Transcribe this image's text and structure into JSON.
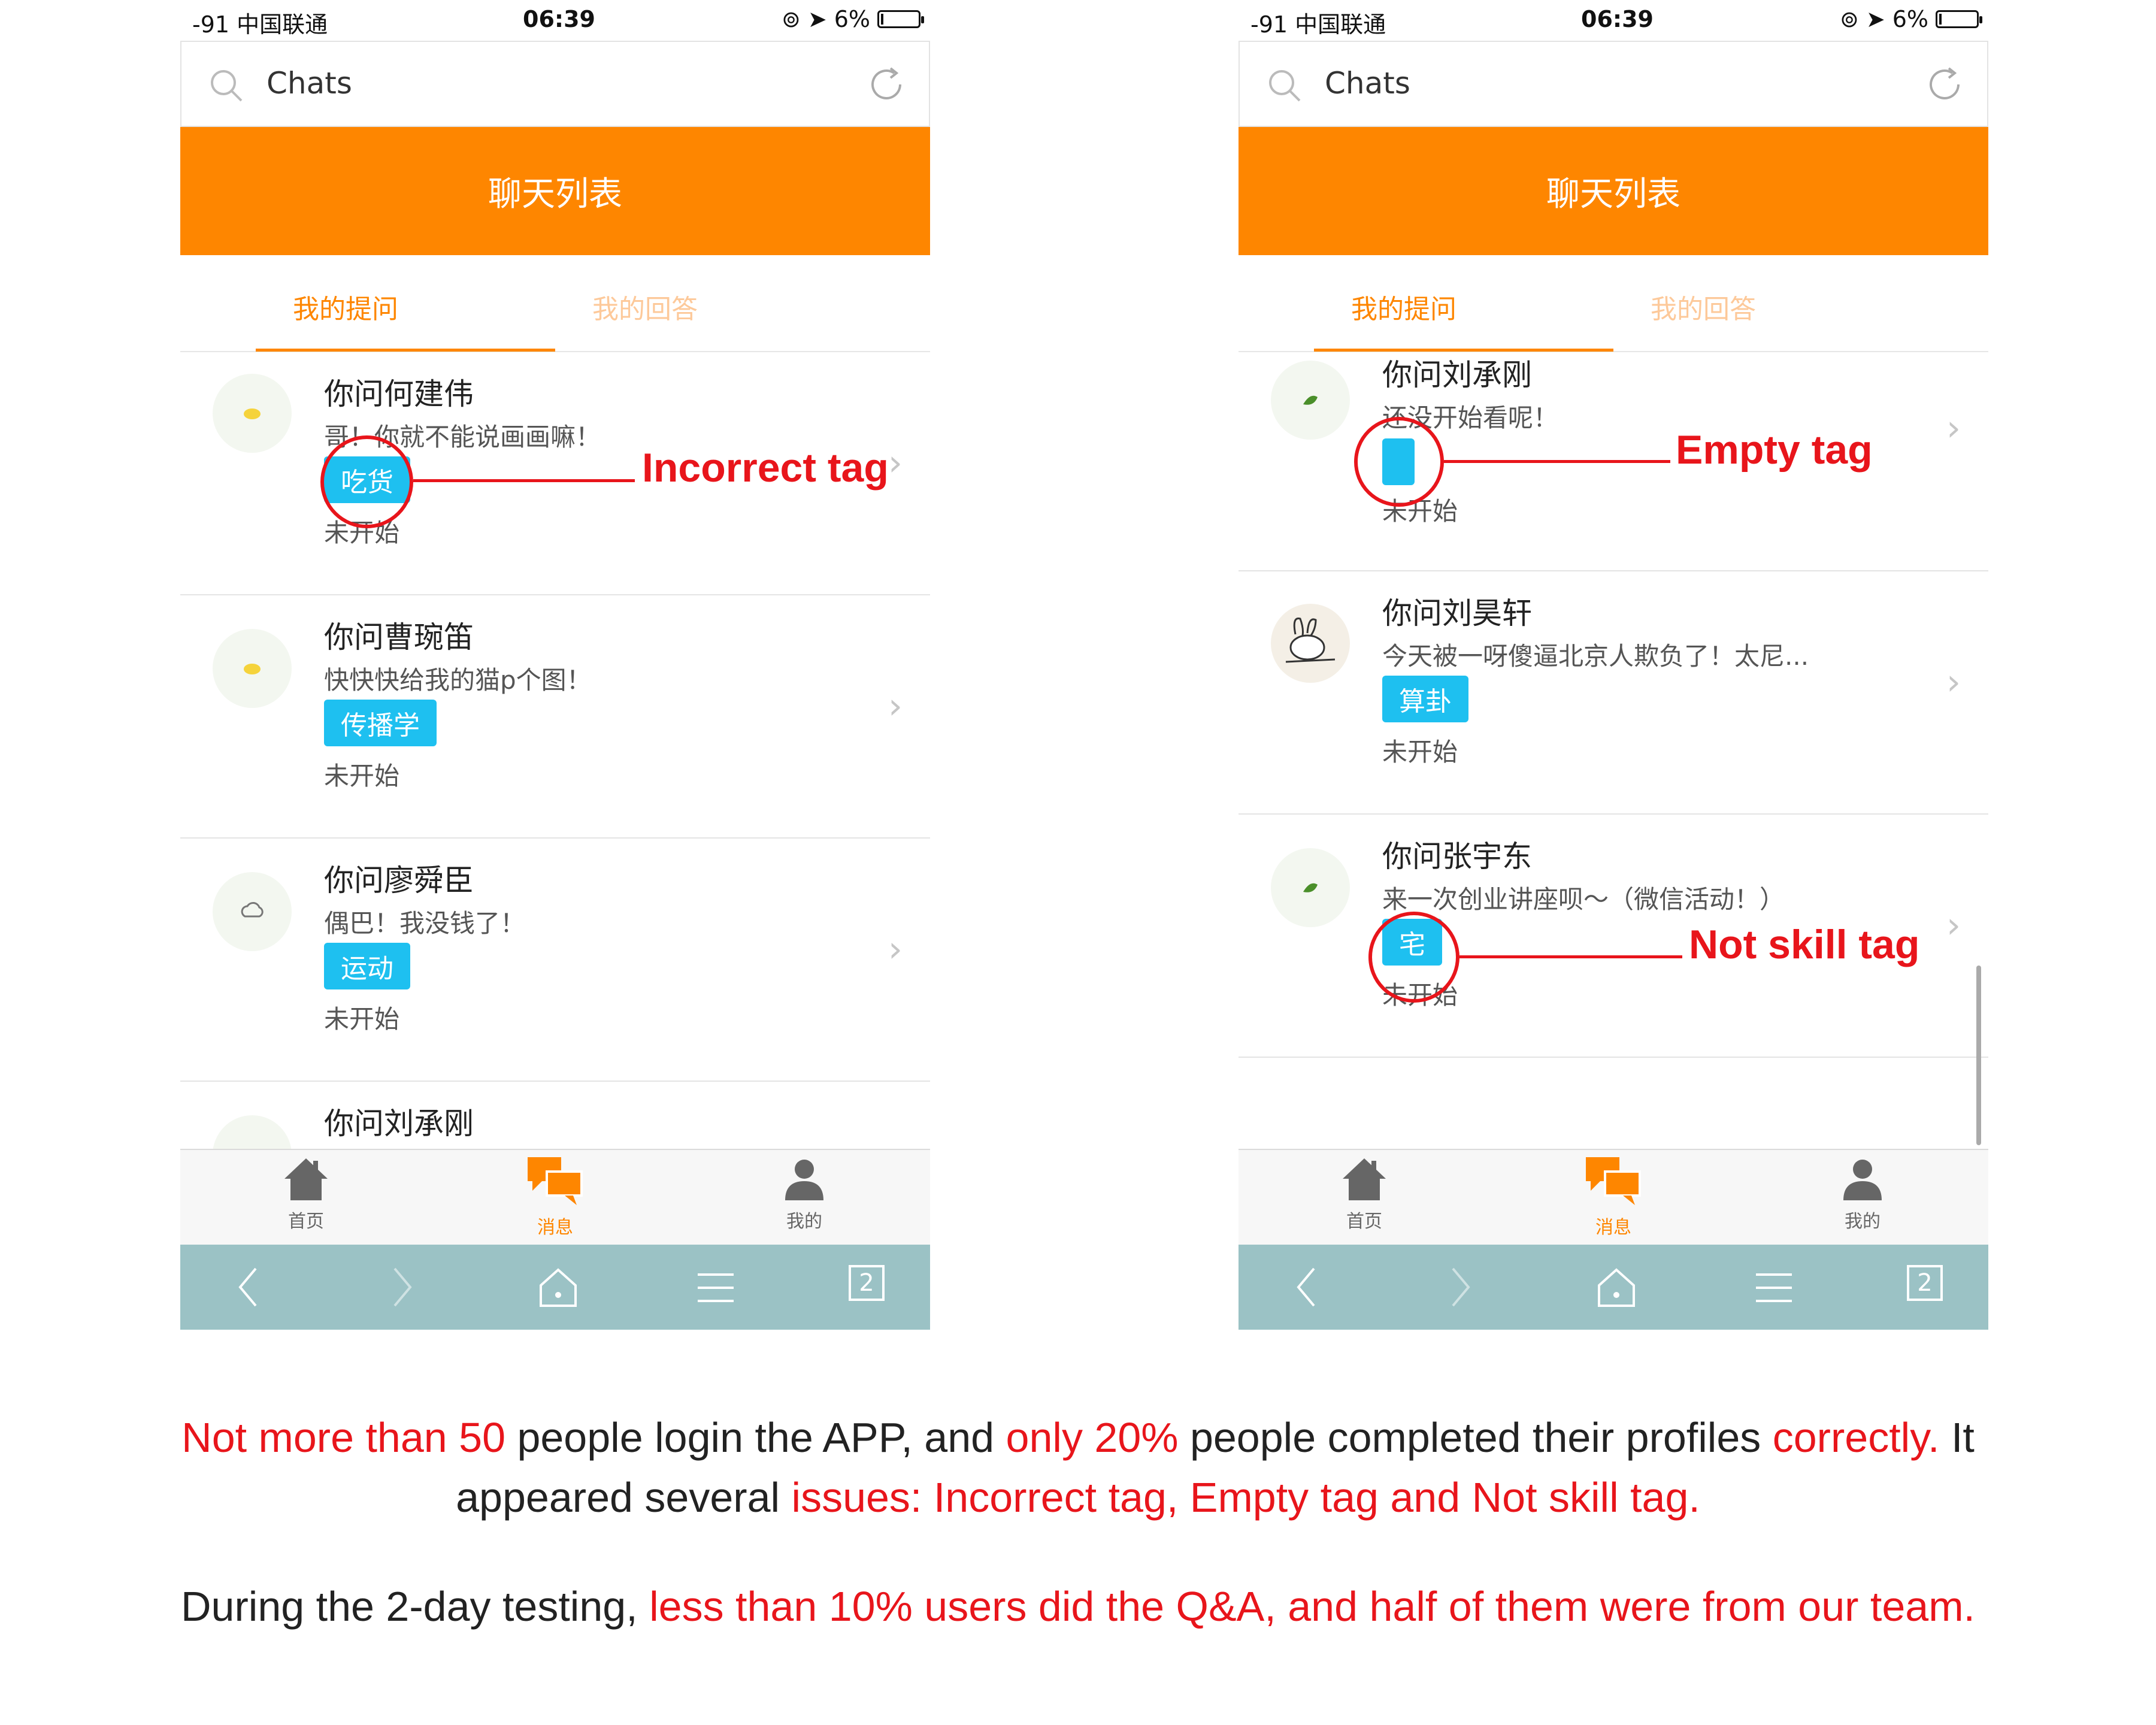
{
  "colors": {
    "accent": "#fe8600",
    "tag": "#1ec0f0",
    "annotation": "#e8151b",
    "browser_bar": "#9bc2c5"
  },
  "phones": [
    {
      "status": {
        "carrier": "-91 中国联通",
        "time": "06:39",
        "battery": "6%",
        "battery_level": 0.06
      },
      "search_placeholder": "Chats",
      "header_title": "聊天列表",
      "tabs": [
        {
          "label": "我的提问"
        },
        {
          "label": "我的回答"
        }
      ],
      "rows": [
        {
          "title": "你问何建伟",
          "preview": "哥！你就不能说画画嘛！",
          "tag": "吃货",
          "status": "未开始",
          "avatar": "bird-icon"
        },
        {
          "title": "你问曹琬笛",
          "preview": "快快快给我的猫p个图！",
          "tag": "传播学",
          "status": "未开始",
          "avatar": "bird-icon"
        },
        {
          "title": "你问廖舜臣",
          "preview": "偶巴！我没钱了！",
          "tag": "运动",
          "status": "未开始",
          "avatar": "cloud-icon"
        },
        {
          "title": "你问刘承刚",
          "preview": "",
          "tag": "",
          "status": "",
          "avatar": "leaf-icon"
        }
      ],
      "tabbar": [
        {
          "label": "首页",
          "icon": "home-icon"
        },
        {
          "label": "消息",
          "icon": "chat-bubbles-icon"
        },
        {
          "label": "我的",
          "icon": "user-icon"
        }
      ],
      "browser": {
        "tab_count": "2"
      },
      "annotation": "Incorrect tag"
    },
    {
      "status": {
        "carrier": "-91 中国联通",
        "time": "06:39",
        "battery": "6%",
        "battery_level": 0.06
      },
      "search_placeholder": "Chats",
      "header_title": "聊天列表",
      "tabs": [
        {
          "label": "我的提问"
        },
        {
          "label": "我的回答"
        }
      ],
      "rows": [
        {
          "title": "你问刘承刚",
          "preview": "还没开始看呢！",
          "tag": "",
          "status": "未开始",
          "avatar": "leaf-icon"
        },
        {
          "title": "你问刘昊轩",
          "preview": "今天被一呀傻逼北京人欺负了！太尼...",
          "tag": "算卦",
          "status": "未开始",
          "avatar": "rabbit-icon"
        },
        {
          "title": "你问张宇东",
          "preview": "来一次创业讲座呗～（微信活动！）",
          "tag": "宅",
          "status": "未开始",
          "avatar": "leaf-icon"
        }
      ],
      "tabbar": [
        {
          "label": "首页",
          "icon": "home-icon"
        },
        {
          "label": "消息",
          "icon": "chat-bubbles-icon"
        },
        {
          "label": "我的",
          "icon": "user-icon"
        }
      ],
      "browser": {
        "tab_count": "2"
      },
      "annotations": [
        "Empty tag",
        "Not skill tag"
      ]
    }
  ],
  "caption": {
    "p1_a": "Not more than 50",
    "p1_b": " people login the APP, and ",
    "p1_c": "only 20%",
    "p1_d": " people completed their profiles ",
    "p1_e": "correctly.",
    "p1_f": " It",
    "p2_a": "appeared several ",
    "p2_b": "issues: Incorrect tag, Empty tag and Not skill tag.",
    "p3_a": "During the 2-day testing, ",
    "p3_b": "less than 10% users did the Q&A, and half of them were from our team."
  }
}
